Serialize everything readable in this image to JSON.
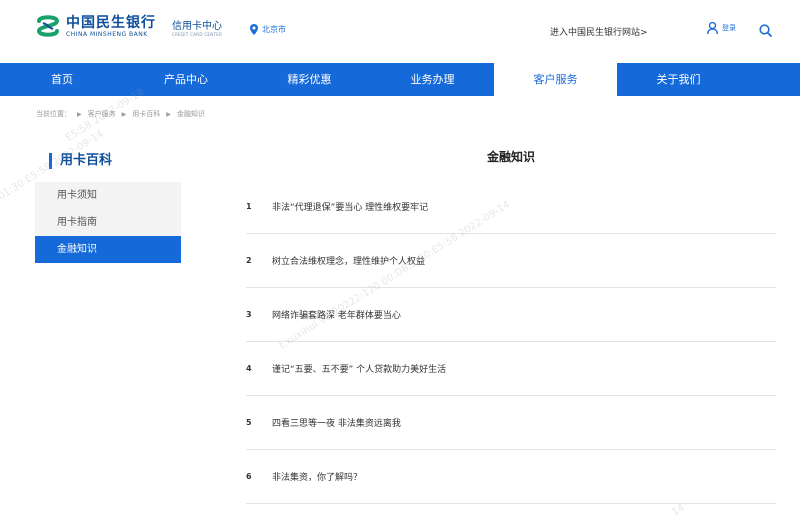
{
  "header": {
    "logo_cn": "中国民生银行",
    "logo_en": "CHINA MINSHENG BANK",
    "card_center_cn": "信用卡中心",
    "card_center_en": "CREDIT CARD CENTER",
    "city": "北京市",
    "go_main_site": "进入中国民生银行网站>",
    "login_label": "登录",
    "brand_color": "#0f4e9a"
  },
  "nav": {
    "items": [
      {
        "label": "首页"
      },
      {
        "label": "产品中心"
      },
      {
        "label": "精彩优惠"
      },
      {
        "label": "业务办理"
      },
      {
        "label": "客户服务"
      },
      {
        "label": "关于我们"
      }
    ],
    "active_index": 4,
    "color": "#1669d8"
  },
  "breadcrumb": {
    "prefix": "当前位置：",
    "items": [
      "客户服务",
      "用卡百科",
      "金融知识"
    ]
  },
  "sidebar": {
    "title": "用卡百科",
    "items": [
      {
        "label": "用卡须知"
      },
      {
        "label": "用卡指南"
      },
      {
        "label": "金融知识"
      }
    ],
    "active_index": 2
  },
  "main": {
    "title": "金融知识",
    "articles": [
      {
        "num": "1",
        "title": "非法“代理退保”要当心 理性维权要牢记"
      },
      {
        "num": "2",
        "title": "树立合法维权理念，理性维护个人权益"
      },
      {
        "num": "3",
        "title": "网络诈骗套路深 老年群体要当心"
      },
      {
        "num": "4",
        "title": "谨记“五要、五不要” 个人贷款助力美好生活"
      },
      {
        "num": "5",
        "title": "四看三思等一夜 非法集资远离我"
      },
      {
        "num": "6",
        "title": "非法集资，你了解吗？"
      }
    ]
  },
  "watermarks": [
    "E5:58 2022-09-14",
    "01:30 E5:58 2022-09-14",
    "t.xuxihui 95:20222:120 00:D8:2:30:E5:58 2022-09-14",
    "14"
  ]
}
